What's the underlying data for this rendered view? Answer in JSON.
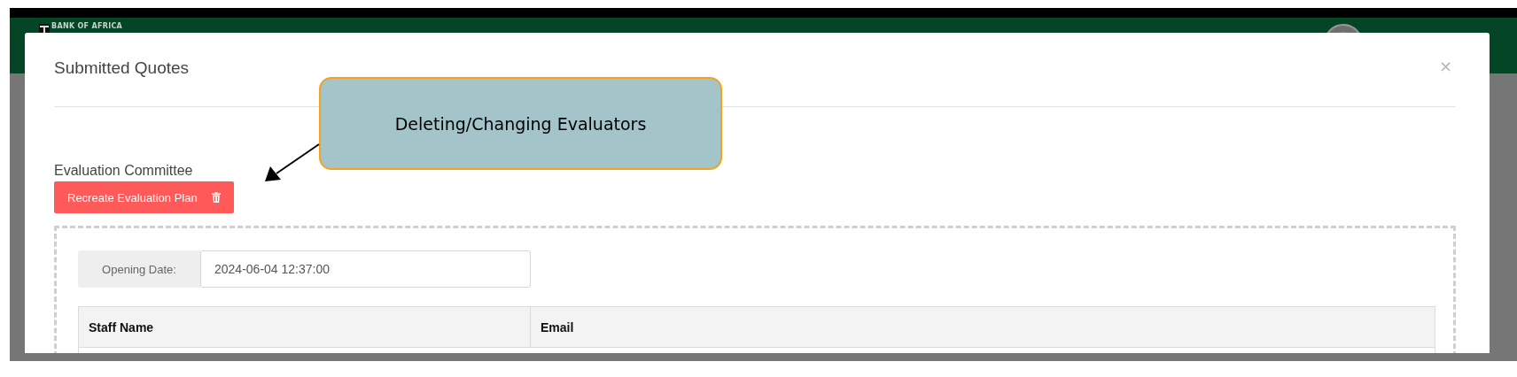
{
  "header": {
    "logo_text": "BANK OF AFRICA"
  },
  "modal": {
    "title": "Submitted Quotes",
    "close": "×",
    "section_title": "Evaluation Committee",
    "recreate_button": "Recreate Evaluation Plan",
    "opening_date": {
      "label": "Opening Date:",
      "value": "2024-06-04 12:37:00"
    },
    "table": {
      "columns": [
        "Staff Name",
        "Email"
      ]
    }
  },
  "annotation": {
    "text": "Deleting/Changing Evaluators"
  }
}
